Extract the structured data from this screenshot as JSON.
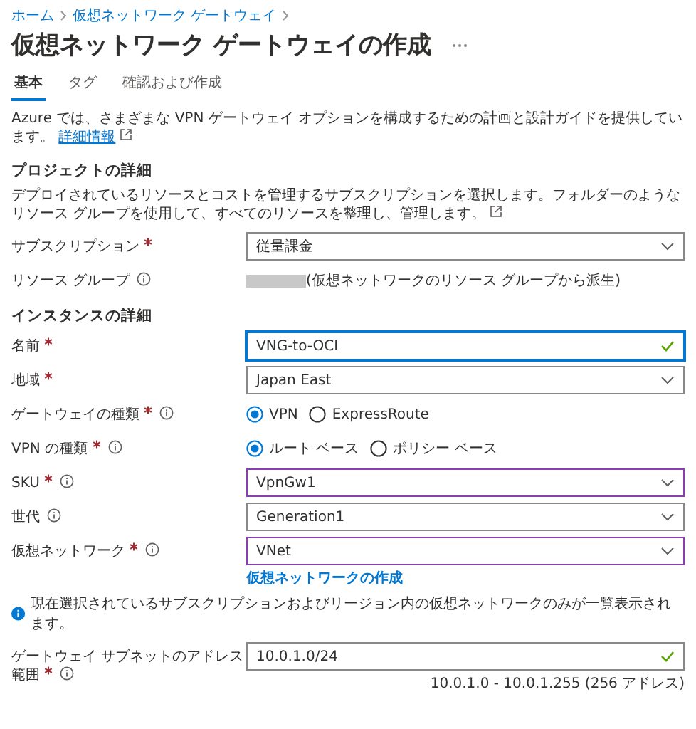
{
  "breadcrumb": [
    {
      "label": "ホーム"
    },
    {
      "label": "仮想ネットワーク ゲートウェイ"
    }
  ],
  "title": "仮想ネットワーク ゲートウェイの作成",
  "tabs": [
    {
      "label": "基本",
      "selected": true
    },
    {
      "label": "タグ",
      "selected": false
    },
    {
      "label": "確認および作成",
      "selected": false
    }
  ],
  "intro": {
    "text": "Azure では、さまざまな VPN ゲートウェイ オプションを構成するための計画と設計ガイドを提供しています。",
    "link": "詳細情報"
  },
  "sections": [
    {
      "heading": "プロジェクトの詳細",
      "description": "デプロイされているリソースとコストを管理するサブスクリプションを選択します。フォルダーのようなリソース グループを使用して、すべてのリソースを整理し、管理します。",
      "fields": [
        {
          "kind": "select",
          "label": "サブスクリプション",
          "required": true,
          "info": false,
          "value": "従量課金"
        },
        {
          "kind": "static",
          "label": "リソース グループ",
          "required": false,
          "info": true,
          "redacted": true,
          "value": "(仮想ネットワークのリソース グループから派生)"
        }
      ]
    },
    {
      "heading": "インスタンスの詳細",
      "fields": [
        {
          "kind": "text",
          "label": "名前",
          "required": true,
          "info": false,
          "value": "VNG-to-OCI",
          "valid": true,
          "focused": true
        },
        {
          "kind": "select",
          "label": "地域",
          "required": true,
          "info": false,
          "value": "Japan East"
        },
        {
          "kind": "radio",
          "label": "ゲートウェイの種類",
          "required": true,
          "info": true,
          "options": [
            {
              "label": "VPN",
              "selected": true
            },
            {
              "label": "ExpressRoute",
              "selected": false
            }
          ]
        },
        {
          "kind": "radio",
          "label": "VPN の種類",
          "required": true,
          "info": true,
          "options": [
            {
              "label": "ルート ベース",
              "selected": true
            },
            {
              "label": "ポリシー ベース",
              "selected": false
            }
          ]
        },
        {
          "kind": "select",
          "label": "SKU",
          "required": true,
          "info": true,
          "value": "VpnGw1",
          "highlighted": true
        },
        {
          "kind": "select",
          "label": "世代",
          "required": false,
          "info": true,
          "value": "Generation1"
        },
        {
          "kind": "select",
          "label": "仮想ネットワーク",
          "required": true,
          "info": true,
          "value": "VNet",
          "highlighted": true,
          "link": "仮想ネットワークの作成"
        },
        {
          "kind": "note",
          "value": "現在選択されているサブスクリプションおよびリージョン内の仮想ネットワークのみが一覧表示されます。"
        },
        {
          "kind": "text",
          "label": "ゲートウェイ サブネットのアドレス範囲",
          "required": true,
          "info": true,
          "value": "10.0.1.0/24",
          "valid": true,
          "hint": "10.0.1.0 - 10.0.1.255 (256 アドレス)"
        }
      ]
    }
  ]
}
